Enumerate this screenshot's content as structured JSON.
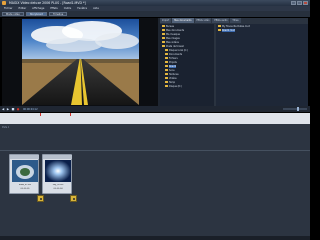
{
  "window": {
    "title": "MAGIX Video deluxe 2006 PLUS - [Road1.MVD *]"
  },
  "menu": [
    "Fichier",
    "Editer",
    "Affichage",
    "Effets",
    "Outils",
    "Fenêtre",
    "Aide"
  ],
  "toolbar": {
    "mode_tabs": [
      "Mode vidéo",
      "Storyboard",
      "Timeline"
    ],
    "active_index": 1
  },
  "browser": {
    "tabs": [
      "Import",
      "Mes documents",
      "Effets vidéo",
      "Effets audio",
      "Titres"
    ],
    "active_index": 1,
    "tree": [
      {
        "label": "Bureau",
        "selected": false
      },
      {
        "label": "Mes documents",
        "selected": false
      },
      {
        "label": "Ma musique",
        "selected": false
      },
      {
        "label": "Mes images",
        "selected": false
      },
      {
        "label": "Mes vidéos",
        "selected": false
      },
      {
        "label": "Poste de travail",
        "selected": false
      },
      {
        "label": "Disque local (C:)",
        "selected": false
      },
      {
        "label": "Documents",
        "selected": false
      },
      {
        "label": "Fichiers",
        "selected": false
      },
      {
        "label": "Projets",
        "selected": false
      },
      {
        "label": "Road1",
        "selected": true
      },
      {
        "label": "Sons",
        "selected": false
      },
      {
        "label": "Textures",
        "selected": false
      },
      {
        "label": "Vidéos",
        "selected": false
      },
      {
        "label": "Temp",
        "selected": false
      },
      {
        "label": "Disque (D:)",
        "selected": false
      }
    ],
    "files": [
      {
        "label": "My Favourite Dates.mvd",
        "selected": false
      },
      {
        "label": "Road1.mvd",
        "selected": true
      }
    ]
  },
  "transport": {
    "timecode": "00:00:04:12"
  },
  "timeline": {
    "track_label": "Piste 1",
    "clips": [
      {
        "name": "Road_01.avi",
        "duration": "00:00:05"
      },
      {
        "name": "Sky_02.avi",
        "duration": "00:00:04"
      }
    ]
  },
  "colors": {
    "accent": "#3c6bb0",
    "folder": "#e5b840",
    "marker": "#d1332b"
  }
}
